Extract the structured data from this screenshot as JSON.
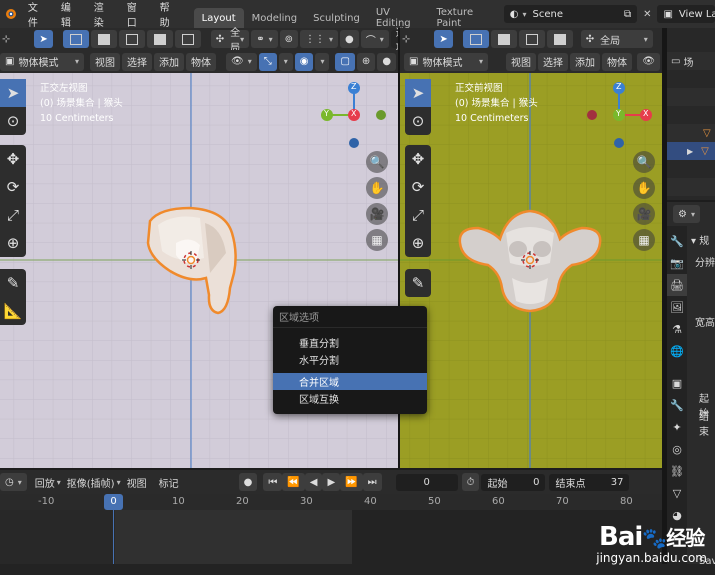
{
  "topbar": {
    "menus": [
      "文件",
      "编辑",
      "渲染",
      "窗口",
      "帮助"
    ],
    "workspace_tabs": [
      "Layout",
      "Modeling",
      "Sculpting",
      "UV Editing",
      "Texture Paint"
    ],
    "active_tab": "Layout",
    "scene_name": "Scene",
    "view_layer": "View Layer"
  },
  "tool_header": {
    "transform_orientation": "全局",
    "options_label": "选项"
  },
  "viewport_left": {
    "mode": "物体模式",
    "menus": [
      "视图",
      "选择",
      "添加",
      "物体"
    ],
    "info_lines": [
      "正交左视图",
      "(0) 场景集合 | 猴头",
      "10 Centimeters"
    ],
    "background_color": "#d2ccd9"
  },
  "viewport_right": {
    "mode": "物体模式",
    "menus": [
      "视图",
      "选择",
      "添加",
      "物体"
    ],
    "info_lines": [
      "正交前视图",
      "(0) 场景集合 | 猴头",
      "10 Centimeters"
    ],
    "background_color": "#9b9e24"
  },
  "context_menu": {
    "title": "区域选项",
    "items": [
      "垂直分割",
      "水平分割",
      "合并区域",
      "区域互换"
    ],
    "highlighted": "合并区域"
  },
  "timeline": {
    "menus": [
      "回放",
      "抠像(插帧)",
      "视图",
      "标记"
    ],
    "current_frame": "0",
    "start_label": "起始",
    "start_value": "0",
    "end_label": "结束点",
    "end_value": "37",
    "ruler_ticks": [
      "-10",
      "0",
      "10",
      "20",
      "30",
      "40",
      "50",
      "60",
      "70",
      "80"
    ],
    "playhead": "0"
  },
  "outliner": {
    "label": "场"
  },
  "properties": {
    "labels": [
      "规",
      "分辨",
      "宽高",
      "起始",
      "结束",
      "Save"
    ]
  },
  "gizmo": {
    "x": "X",
    "y": "Y",
    "z": "Z"
  },
  "watermark": {
    "brand": "Bai",
    "brand2": "经验",
    "url": "jingyan.baidu.com"
  },
  "colors": {
    "accent": "#4772b3",
    "axis_x": "#e63c4b",
    "axis_y": "#7ab82c",
    "axis_z": "#3a80d4",
    "selection_outline": "#f08a2c"
  }
}
